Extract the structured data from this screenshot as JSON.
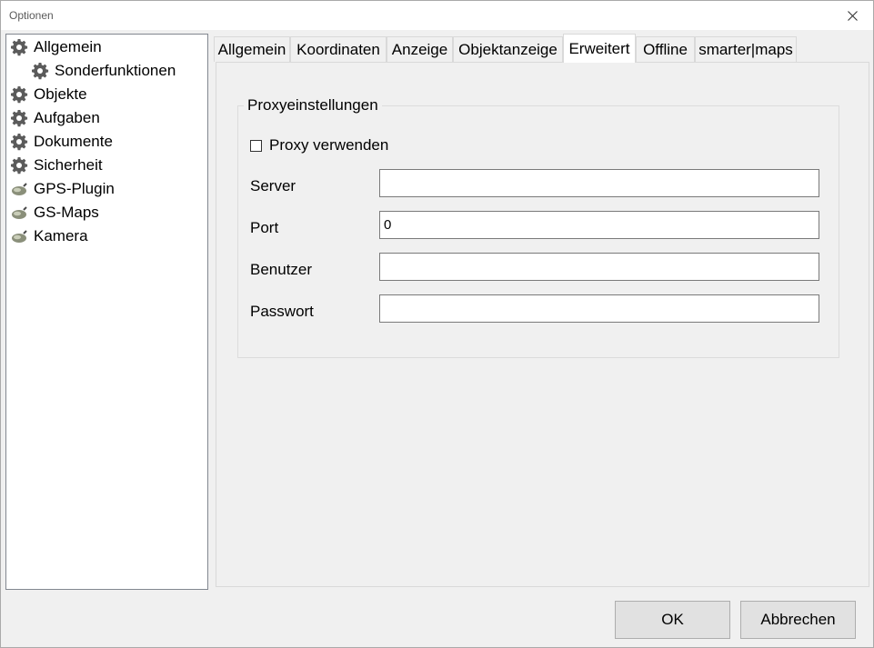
{
  "window": {
    "title": "Optionen"
  },
  "tree": {
    "items": [
      {
        "label": "Allgemein",
        "icon": "gear-icon"
      },
      {
        "label": "Sonderfunktionen",
        "icon": "gear-icon"
      },
      {
        "label": "Objekte",
        "icon": "gear-icon"
      },
      {
        "label": "Aufgaben",
        "icon": "gear-icon"
      },
      {
        "label": "Dokumente",
        "icon": "gear-icon"
      },
      {
        "label": "Sicherheit",
        "icon": "gear-icon"
      },
      {
        "label": "GPS-Plugin",
        "icon": "plugin-icon"
      },
      {
        "label": "GS-Maps",
        "icon": "plugin-icon"
      },
      {
        "label": "Kamera",
        "icon": "plugin-icon"
      }
    ]
  },
  "tabs": {
    "items": [
      {
        "label": "Allgemein"
      },
      {
        "label": "Koordinaten"
      },
      {
        "label": "Anzeige"
      },
      {
        "label": "Objektanzeige"
      },
      {
        "label": "Erweitert"
      },
      {
        "label": "Offline"
      },
      {
        "label": "smarter|maps"
      }
    ],
    "active": "Erweitert"
  },
  "proxy": {
    "group_title": "Proxyeinstellungen",
    "use_proxy_label": "Proxy verwenden",
    "use_proxy_checked": false,
    "server_label": "Server",
    "server_value": "",
    "port_label": "Port",
    "port_value": "0",
    "user_label": "Benutzer",
    "user_value": "",
    "password_label": "Passwort",
    "password_value": ""
  },
  "buttons": {
    "ok": "OK",
    "cancel": "Abbrechen"
  },
  "colors": {
    "window_bg": "#f0f0f0",
    "panel_border": "#d9d9d9",
    "button_bg": "#e1e1e1"
  }
}
